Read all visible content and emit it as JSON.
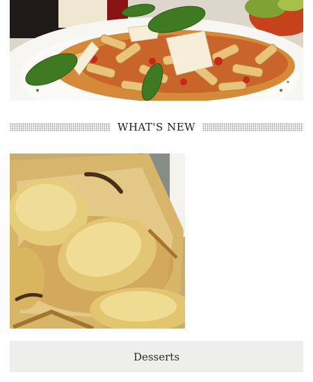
{
  "hero": {
    "image": "pasta-penne-basil-parmesan"
  },
  "section": {
    "title": "WHAT'S NEW"
  },
  "feature": {
    "image": "pear-tart-pastry"
  },
  "category": {
    "label": "Desserts"
  },
  "colors": {
    "background": "#ffffff",
    "category_bar": "#eeeeec",
    "heading_text": "#1e1e1e",
    "dots": "#8a8a8a"
  }
}
